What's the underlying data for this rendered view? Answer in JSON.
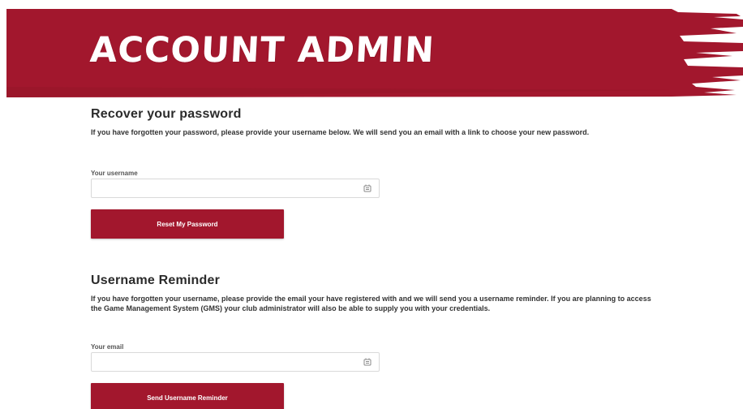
{
  "banner": {
    "title": "ACCOUNT ADMIN",
    "color": "#a2172d"
  },
  "recover": {
    "title": "Recover your password",
    "description": "If you have forgotten your password, please provide your username below. We will send you an email with a link to choose your new password.",
    "field_label": "Your username",
    "field_value": "",
    "field_placeholder": "",
    "field_icon": "autofill-icon",
    "button_label": "Reset My Password"
  },
  "reminder": {
    "title": "Username Reminder",
    "description": "If you have forgotten your username, please provide the email your have registered with and we will send you a username reminder. If you are planning to access the Game Management System (GMS) your club administrator will also be able to supply you with your credentials.",
    "field_label": "Your email",
    "field_value": "",
    "field_placeholder": "",
    "field_icon": "autofill-icon",
    "button_label": "Send Username Reminder"
  }
}
